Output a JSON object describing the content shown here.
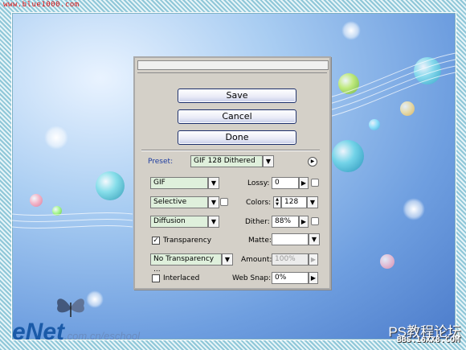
{
  "watermarks": {
    "top_url": "www.blue1000.com",
    "enet_big": "eNet",
    "enet_small": ".com.cn/eschool",
    "ps_forum": "PS教程论坛",
    "bbs": "BBS.16XX8.COM"
  },
  "dialog": {
    "buttons": {
      "save": "Save",
      "cancel": "Cancel",
      "done": "Done"
    },
    "preset": {
      "label": "Preset:",
      "value": "GIF 128 Dithered"
    },
    "format": {
      "value": "GIF"
    },
    "lossy": {
      "label": "Lossy:",
      "value": "0"
    },
    "reduction": {
      "value": "Selective"
    },
    "colors": {
      "label": "Colors:",
      "value": "128"
    },
    "dither_algorithm": {
      "value": "Diffusion"
    },
    "dither": {
      "label": "Dither:",
      "value": "88%"
    },
    "transparency": {
      "label": "Transparency",
      "checked": true
    },
    "matte": {
      "label": "Matte:",
      "value": ""
    },
    "transparency_dither": {
      "value": "No Transparency ..."
    },
    "amount": {
      "label": "Amount:",
      "value": "100%"
    },
    "interlaced": {
      "label": "Interlaced",
      "checked": false
    },
    "web_snap": {
      "label": "Web Snap:",
      "value": "0%"
    }
  },
  "colors": {
    "accent_blue": "#1f3da0",
    "field_green": "#dff0dc",
    "dialog_gray": "#d4d0c8"
  },
  "icons": {
    "dropdown": "chevron-down-icon",
    "next": "right-arrow-icon",
    "menu": "circle-arrow-icon",
    "check": "checkmark-icon"
  }
}
